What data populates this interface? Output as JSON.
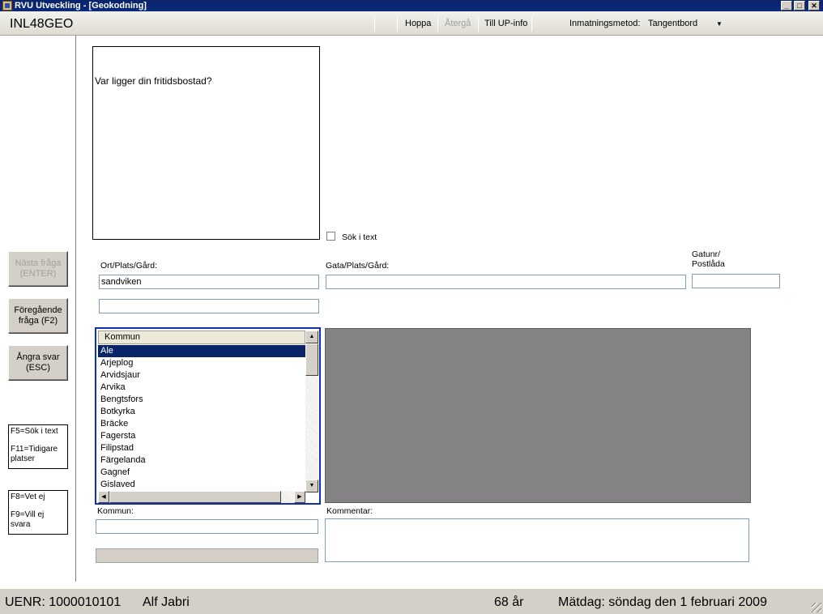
{
  "window": {
    "title": "RVU Utveckling - [Geokodning]",
    "minimize": "_",
    "maximize": "□",
    "close": "✕"
  },
  "toolbar": {
    "code": "INL48GEO",
    "hoppa": "Hoppa",
    "atergå": "Återgå",
    "till_up_info": "Till UP-info",
    "input_method_label": "Inmatningsmetod:",
    "input_method_value": "Tangentbord"
  },
  "nav": {
    "next": "Nästa fråga (ENTER)",
    "prev": "Föregående fråga (F2)",
    "undo": "Ångra svar (ESC)"
  },
  "help1": {
    "line1": "F5=Sök i text",
    "line2": "F11=Tidigare platser"
  },
  "help2": {
    "line1": "F8=Vet ej",
    "line2": "F9=Vill ej svara"
  },
  "question": {
    "text": "Var ligger din fritidsbostad?"
  },
  "search_in_text": "Sök i text",
  "fields": {
    "ort_label": "Ort/Plats/Gård:",
    "ort_value": "sandviken",
    "gata_label": "Gata/Plats/Gård:",
    "gatunr_label": "Gatunr/ Postlåda",
    "kommun_label": "Kommun:",
    "kommentar_label": "Kommentar:"
  },
  "kommun_list": {
    "header": "Kommun",
    "items": [
      "Ale",
      "Arjeplog",
      "Arvidsjaur",
      "Arvika",
      "Bengtsfors",
      "Botkyrka",
      "Bräcke",
      "Fagersta",
      "Filipstad",
      "Färgelanda",
      "Gagnef",
      "Gislaved"
    ],
    "selected_index": 0
  },
  "status": {
    "uenr": "UENR: 1000010101",
    "name": "Alf Jabri",
    "age": "68 år",
    "matdag": "Mätdag: söndag den 1 februari 2009"
  }
}
